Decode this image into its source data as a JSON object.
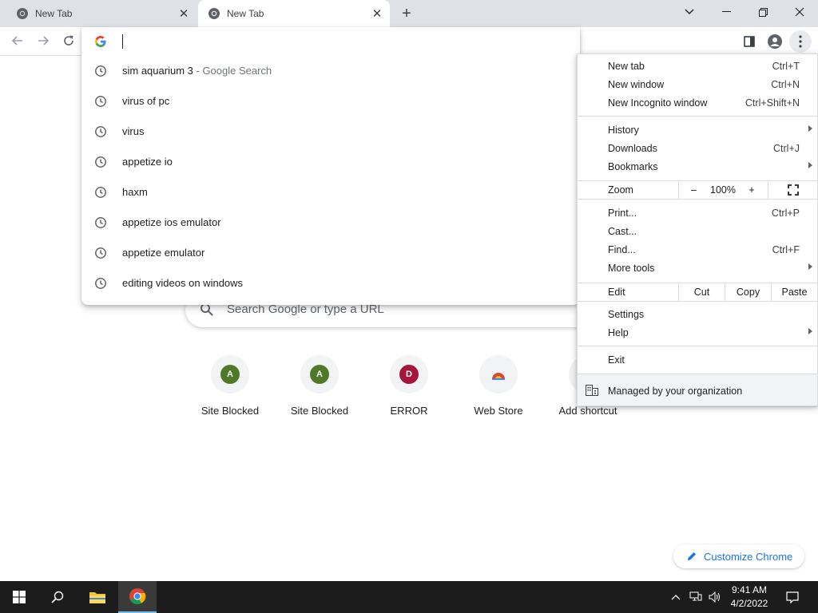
{
  "browser": {
    "tabs": [
      {
        "title": "New Tab",
        "active": false
      },
      {
        "title": "New Tab",
        "active": true
      }
    ],
    "window_controls": [
      "minimize",
      "restore",
      "close"
    ]
  },
  "omnibox": {
    "input_value": "",
    "suggestions": [
      {
        "text": "sim aquarium 3",
        "suffix": "- Google Search"
      },
      {
        "text": "virus of pc",
        "suffix": ""
      },
      {
        "text": "virus",
        "suffix": ""
      },
      {
        "text": "appetize io",
        "suffix": ""
      },
      {
        "text": "haxm",
        "suffix": ""
      },
      {
        "text": "appetize ios emulator",
        "suffix": ""
      },
      {
        "text": "appetize emulator",
        "suffix": ""
      },
      {
        "text": "editing videos on windows",
        "suffix": ""
      }
    ]
  },
  "ntp": {
    "search_placeholder": "Search Google or type a URL",
    "shortcuts": [
      {
        "letter": "A",
        "label": "Site Blocked",
        "color": "#4e7a27"
      },
      {
        "letter": "A",
        "label": "Site Blocked",
        "color": "#4e7a27"
      },
      {
        "letter": "D",
        "label": "ERROR",
        "color": "#a4163a"
      },
      {
        "letter": "",
        "label": "Web Store",
        "color": ""
      },
      {
        "letter": "",
        "label": "Add shortcut",
        "color": ""
      }
    ],
    "customize_label": "Customize Chrome"
  },
  "menu": {
    "new_tab": {
      "label": "New tab",
      "shortcut": "Ctrl+T"
    },
    "new_window": {
      "label": "New window",
      "shortcut": "Ctrl+N"
    },
    "incognito": {
      "label": "New Incognito window",
      "shortcut": "Ctrl+Shift+N"
    },
    "history": {
      "label": "History"
    },
    "downloads": {
      "label": "Downloads",
      "shortcut": "Ctrl+J"
    },
    "bookmarks": {
      "label": "Bookmarks"
    },
    "zoom": {
      "label": "Zoom",
      "minus": "–",
      "value": "100%",
      "plus": "+"
    },
    "print": {
      "label": "Print...",
      "shortcut": "Ctrl+P"
    },
    "cast": {
      "label": "Cast..."
    },
    "find": {
      "label": "Find...",
      "shortcut": "Ctrl+F"
    },
    "more_tools": {
      "label": "More tools"
    },
    "edit": {
      "label": "Edit",
      "cut": "Cut",
      "copy": "Copy",
      "paste": "Paste"
    },
    "settings": {
      "label": "Settings"
    },
    "help": {
      "label": "Help"
    },
    "exit": {
      "label": "Exit"
    },
    "managed": {
      "label": "Managed by your organization"
    }
  },
  "taskbar": {
    "time": "9:41 AM",
    "date": "4/2/2022"
  },
  "colors": {
    "accent": "#1a73e8",
    "tabstrip": "#dee1e6",
    "taskbar": "#1c1c1c"
  }
}
